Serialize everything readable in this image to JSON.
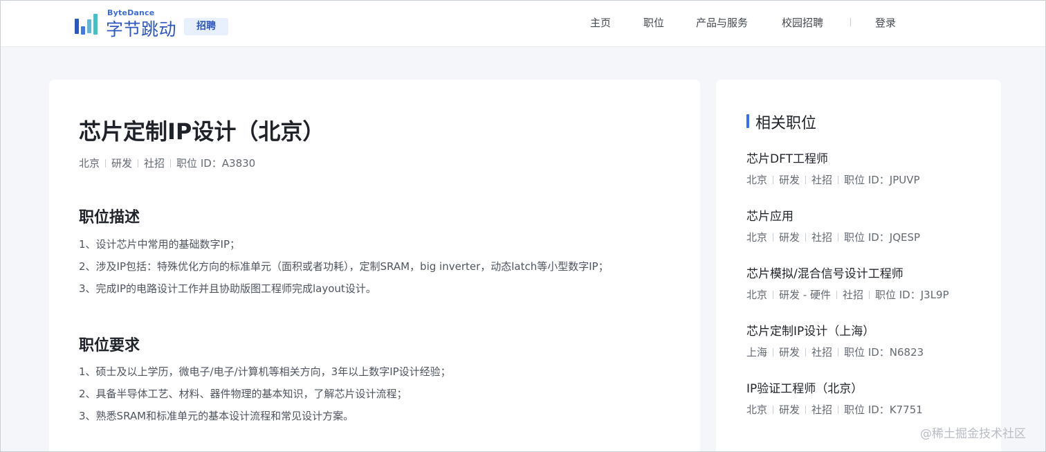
{
  "header": {
    "logo_en": "ByteDance",
    "logo_cn": "字节跳动",
    "logo_badge": "招聘",
    "nav": [
      "主页",
      "职位",
      "产品与服务",
      "校园招聘"
    ],
    "login": "登录"
  },
  "job": {
    "title": "芯片定制IP设计（北京）",
    "meta": [
      "北京",
      "研发",
      "社招",
      "职位 ID：A3830"
    ],
    "description_title": "职位描述",
    "description": [
      "1、设计芯片中常用的基础数字IP；",
      "2、涉及IP包括：特殊优化方向的标准单元（面积或者功耗），定制SRAM，big inverter，动态latch等小型数字IP；",
      "3、完成IP的电路设计工作并且协助版图工程师完成layout设计。"
    ],
    "requirements_title": "职位要求",
    "requirements": [
      "1、硕士及以上学历，微电子/电子/计算机等相关方向，3年以上数字IP设计经验；",
      "2、具备半导体工艺、材料、器件物理的基本知识，了解芯片设计流程；",
      "3、熟悉SRAM和标准单元的基本设计流程和常见设计方案。"
    ]
  },
  "related": {
    "title": "相关职位",
    "jobs": [
      {
        "name": "芯片DFT工程师",
        "meta": [
          "北京",
          "研发",
          "社招",
          "职位 ID：JPUVP"
        ]
      },
      {
        "name": "芯片应用",
        "meta": [
          "北京",
          "研发",
          "社招",
          "职位 ID：JQESP"
        ]
      },
      {
        "name": "芯片模拟/混合信号设计工程师",
        "meta": [
          "北京",
          "研发 - 硬件",
          "社招",
          "职位 ID：J3L9P"
        ]
      },
      {
        "name": "芯片定制IP设计（上海）",
        "meta": [
          "上海",
          "研发",
          "社招",
          "职位 ID：N6823"
        ]
      },
      {
        "name": "IP验证工程师（北京）",
        "meta": [
          "北京",
          "研发",
          "社招",
          "职位 ID：K7751"
        ]
      }
    ]
  },
  "watermark": "@稀土掘金技术社区",
  "colors": {
    "accent": "#3370ff",
    "logo_blue": "#2c57c3",
    "logo_teal": "#3fc3c8"
  }
}
